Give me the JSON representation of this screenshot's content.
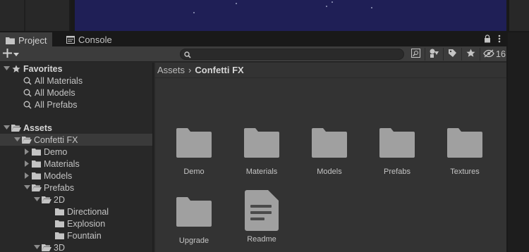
{
  "tabs": {
    "project_label": "Project",
    "console_label": "Console",
    "icons": {
      "project": "folder-icon",
      "console": "console-icon",
      "lock": "lock-icon",
      "menu": "kebab-menu-icon"
    }
  },
  "toolbar": {
    "add_icon": "plus-icon",
    "search_placeholder": "",
    "hidden_count": "16",
    "icons": [
      "search-by-type-icon",
      "filter-by-type-icon",
      "filter-by-label-icon",
      "favorite-star-icon",
      "eye-hidden-icon"
    ]
  },
  "tree": {
    "favorites": {
      "label": "Favorites",
      "items": [
        "All Materials",
        "All Models",
        "All Prefabs"
      ]
    },
    "assets": {
      "label": "Assets",
      "confetti": "Confetti FX",
      "children": [
        "Demo",
        "Materials",
        "Models",
        "Prefabs"
      ],
      "two_d": "2D",
      "two_d_children": [
        "Directional",
        "Explosion",
        "Fountain"
      ],
      "three_d": "3D"
    }
  },
  "breadcrumb": {
    "root": "Assets",
    "separator": "›",
    "current": "Confetti FX"
  },
  "grid": {
    "items": [
      {
        "label": "Demo",
        "icon": "folder-icon"
      },
      {
        "label": "Materials",
        "icon": "folder-icon"
      },
      {
        "label": "Models",
        "icon": "folder-icon"
      },
      {
        "label": "Prefabs",
        "icon": "folder-icon"
      },
      {
        "label": "Textures",
        "icon": "folder-icon"
      },
      {
        "label": "Upgrade",
        "icon": "folder-icon"
      },
      {
        "label": "Readme",
        "icon": "document-icon"
      }
    ]
  },
  "colors": {
    "scene_background": "#1f1f56",
    "panel": "#282828",
    "content": "#333333",
    "toolbar": "#3c3c3c",
    "selection": "#3a3a3a",
    "folder": "#a0a0a0"
  }
}
